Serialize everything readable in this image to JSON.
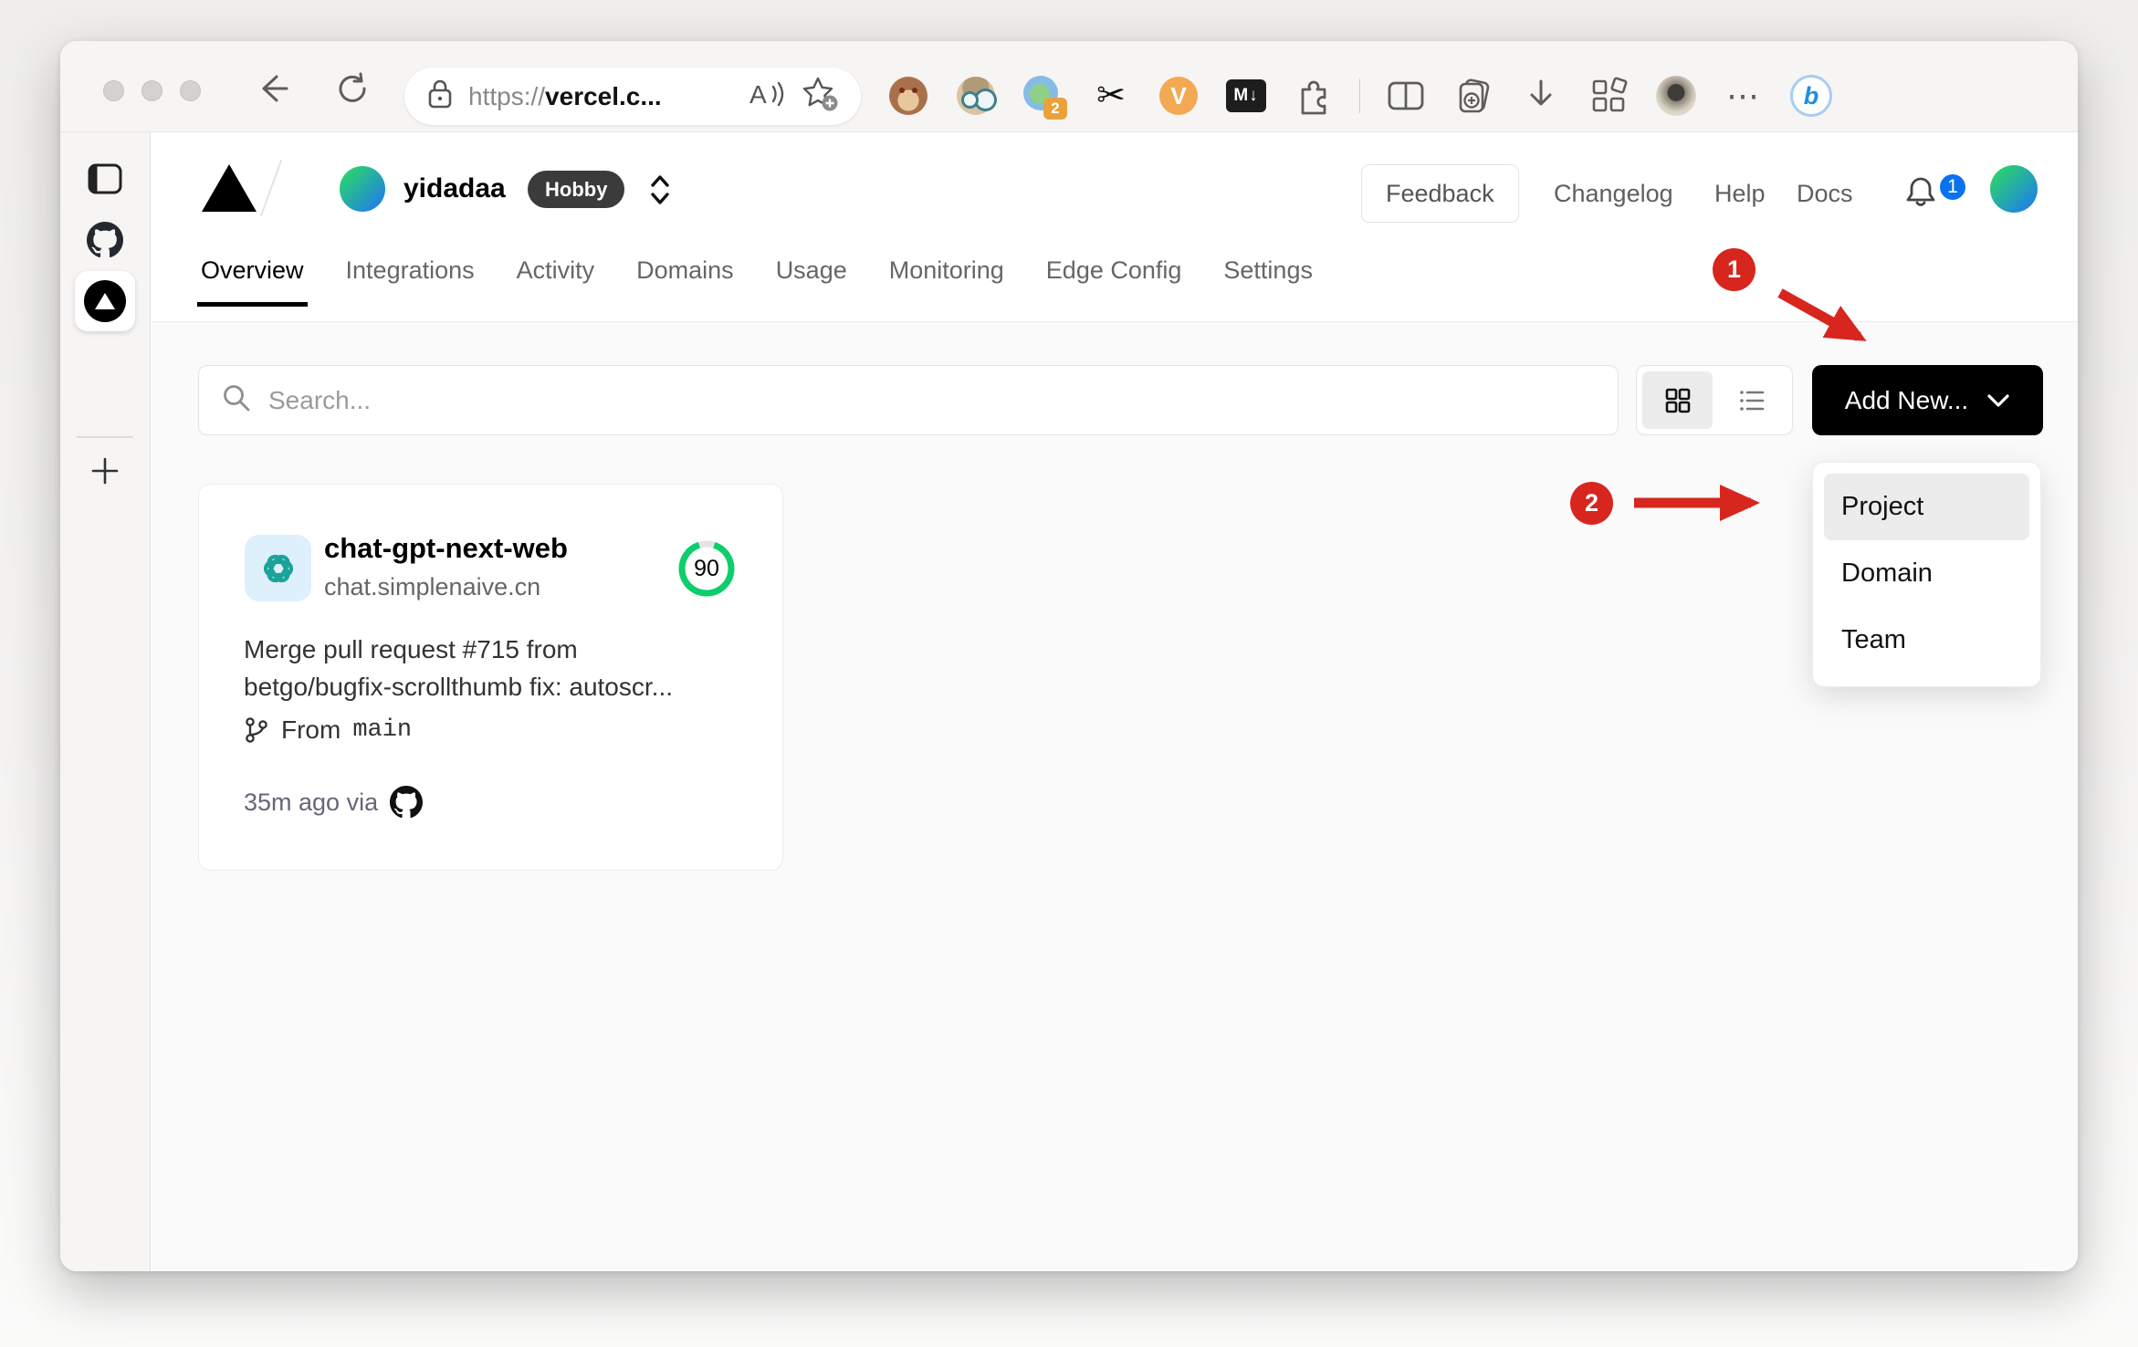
{
  "browser": {
    "url": {
      "scheme": "https://",
      "host": "vercel.c..."
    },
    "extensions": {
      "tab_count_badge": "2",
      "v_label": "V",
      "markdown_label": "M↓",
      "scissors_glyph": "✂",
      "more_label": "⋯",
      "copilot_label": "b"
    }
  },
  "header": {
    "team_name": "yidadaa",
    "plan_badge": "Hobby",
    "links": [
      "Feedback",
      "Changelog",
      "Help",
      "Docs"
    ],
    "notification_count": "1"
  },
  "tabs": [
    {
      "label": "Overview",
      "active": true
    },
    {
      "label": "Integrations"
    },
    {
      "label": "Activity"
    },
    {
      "label": "Domains"
    },
    {
      "label": "Usage"
    },
    {
      "label": "Monitoring"
    },
    {
      "label": "Edge Config"
    },
    {
      "label": "Settings"
    }
  ],
  "toolbar": {
    "search_placeholder": "Search...",
    "add_new_label": "Add New..."
  },
  "project_card": {
    "name": "chat-gpt-next-web",
    "domain": "chat.simplenaive.cn",
    "score": "90",
    "commit_line1": "Merge pull request #715 from",
    "commit_line2": "betgo/bugfix-scrollthumb fix: autoscr...",
    "branch_prefix": "From",
    "branch_name": "main",
    "deployed_meta": "35m ago via"
  },
  "dropdown": {
    "items": [
      {
        "label": "Project",
        "highlighted": true
      },
      {
        "label": "Domain"
      },
      {
        "label": "Team"
      }
    ]
  },
  "annotations": {
    "badge1": "1",
    "badge2": "2"
  },
  "colors": {
    "accent_red": "#d7261d",
    "score_green": "#0cce6b",
    "notification_blue": "#0b72ef",
    "plan_badge_bg": "#3b3b3b"
  }
}
